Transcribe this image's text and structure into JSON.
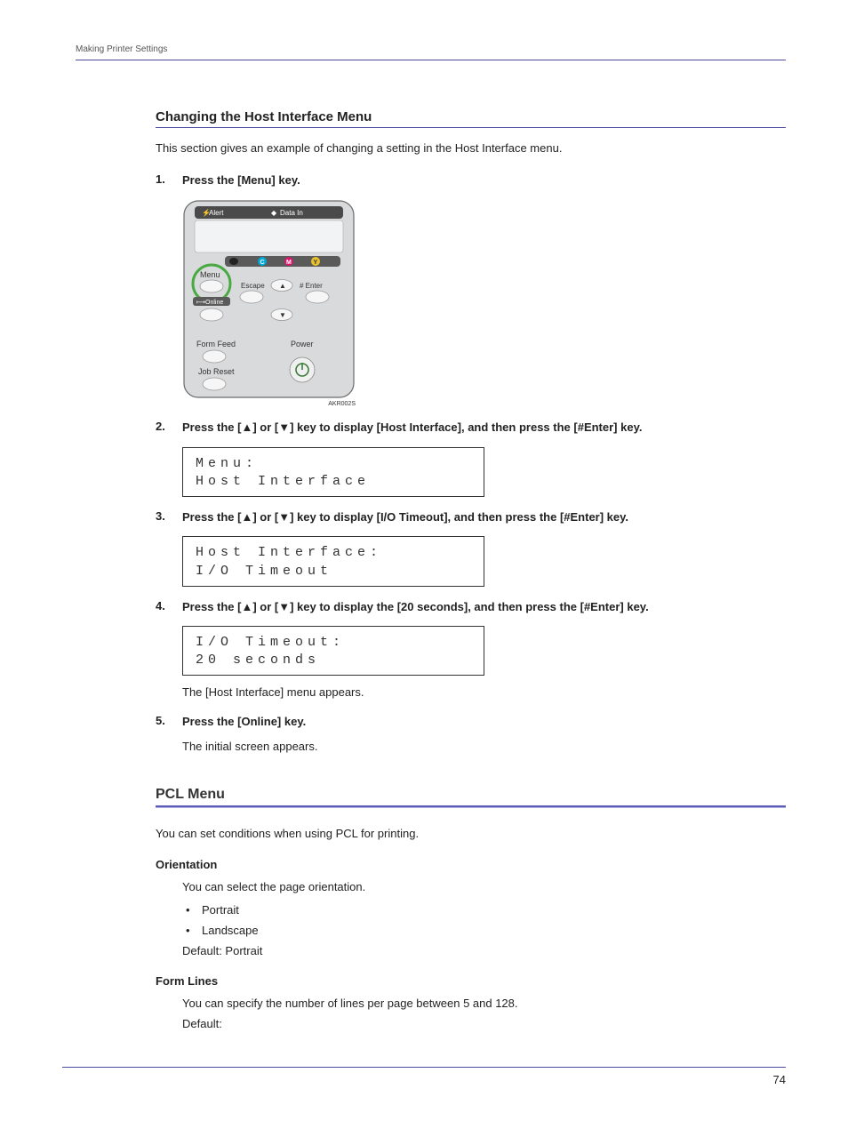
{
  "header": {
    "breadcrumb": "Making Printer Settings"
  },
  "section1": {
    "title": "Changing the Host Interface Menu",
    "intro": "This section gives an example of changing a setting in the Host Interface menu."
  },
  "steps": [
    {
      "num": "1.",
      "label": "Press the [Menu] key.",
      "panel": {
        "alert": "Alert",
        "data_in": "Data In",
        "c": "C",
        "m": "M",
        "y": "Y",
        "menu": "Menu",
        "escape": "Escape",
        "enter": "# Enter",
        "online": "Online",
        "form_feed": "Form Feed",
        "power": "Power",
        "job_reset": "Job Reset",
        "code": "AKR002S"
      }
    },
    {
      "num": "2.",
      "label": "Press the [▲] or [▼] key to display [Host Interface], and then press the [#Enter] key.",
      "lcd1": "Menu:",
      "lcd2": "Host Interface"
    },
    {
      "num": "3.",
      "label": "Press the [▲] or [▼] key to display [I/O Timeout], and then press the [#Enter] key.",
      "lcd1": "Host Interface:",
      "lcd2": "I/O Timeout"
    },
    {
      "num": "4.",
      "label": "Press the [▲] or [▼] key to display the [20 seconds], and then press the [#Enter] key.",
      "lcd1": "I/O Timeout:",
      "lcd2": "20 seconds",
      "after": "The [Host Interface] menu appears."
    },
    {
      "num": "5.",
      "label": "Press the [Online] key.",
      "after": "The initial screen appears."
    }
  ],
  "section2": {
    "title": "PCL Menu",
    "intro": "You can set conditions when using PCL for printing.",
    "items": [
      {
        "name": "Orientation",
        "desc": "You can select the page orientation.",
        "options": [
          "Portrait",
          "Landscape"
        ],
        "default": "Default: Portrait"
      },
      {
        "name": "Form Lines",
        "desc": "You can specify the number of lines per page between 5 and 128.",
        "default": "Default:"
      }
    ]
  },
  "page_number": "74"
}
